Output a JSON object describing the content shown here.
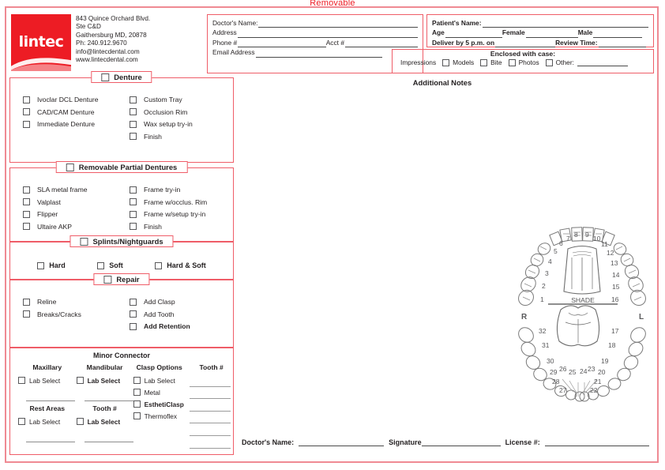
{
  "document": {
    "title": "Removable",
    "additional_notes_label": "Additional Notes"
  },
  "company": {
    "name": "lintec",
    "address_line1": "843 Quince Orchard Blvd.",
    "address_line2": "Ste C&D",
    "address_line3": "Gaithersburg MD, 20878",
    "phone": "Ph: 240.912.9670",
    "email": "info@lintecdental.com",
    "website": "www.lintecdental.com",
    "brand_color": "#ed1c24"
  },
  "doctor_box": {
    "name_label": "Doctor's Name:",
    "address_label": "Address",
    "phone_label": "Phone #",
    "acct_label": "Acct #",
    "email_label": "Email Address"
  },
  "patient_box": {
    "name_label": "Patient's Name:",
    "age_label": "Age",
    "female_label": "Female",
    "male_label": "Male",
    "deliver_label": "Deliver by 5 p.m. on",
    "review_label": "Review Time:"
  },
  "enclosed_box": {
    "title": "Enclosed with case:",
    "items": [
      {
        "label": "Impressions",
        "has_checkbox": false
      },
      {
        "label": "Models",
        "has_checkbox": true
      },
      {
        "label": "Bite",
        "has_checkbox": true
      },
      {
        "label": "Photos",
        "has_checkbox": true
      },
      {
        "label": "Other:",
        "has_checkbox": true
      }
    ]
  },
  "sections": {
    "denture": {
      "title": "Denture",
      "left": [
        "Ivoclar DCL Denture",
        "CAD/CAM Denture",
        "Immediate Denture"
      ],
      "right": [
        "Custom Tray",
        "Occlusion Rim",
        "Wax setup try-in",
        "Finish"
      ]
    },
    "rpd": {
      "title": "Removable Partial Dentures",
      "left": [
        "SLA metal frame",
        "Valplast",
        "Flipper",
        "Ultaire AKP"
      ],
      "right": [
        "Frame try-in",
        "Frame w/occlus. Rim",
        "Frame w/setup try-in",
        "Finish"
      ]
    },
    "splints": {
      "title": "Splints/Nightguards",
      "options": [
        "Hard",
        "Soft",
        "Hard & Soft"
      ]
    },
    "repair": {
      "title": "Repair",
      "left": [
        "Reline",
        "Breaks/Cracks"
      ],
      "right": [
        "Add Clasp",
        "Add Tooth",
        "Add Retention"
      ]
    },
    "minor_connector": {
      "title": "Minor Connector",
      "columns": [
        {
          "header": "Maxillary",
          "option": "Lab Select"
        },
        {
          "header": "Mandibular",
          "option": "Lab Select"
        },
        {
          "header": "Clasp Options",
          "options": [
            "Lab Select",
            "Metal",
            "EsthetiClasp",
            "Thermoflex"
          ]
        },
        {
          "header": "Tooth #",
          "line_count": 6
        }
      ],
      "row2": [
        {
          "header": "Rest Areas",
          "option": "Lab Select"
        },
        {
          "header": "Tooth #",
          "option": "Lab Select"
        }
      ]
    }
  },
  "signature": {
    "doctor_name_label": "Doctor's Name:",
    "signature_label": "Signature",
    "license_label": "License #:"
  },
  "tooth_chart": {
    "shade_label": "SHADE",
    "right_label": "R",
    "left_label": "L",
    "upper_numbers": [
      1,
      2,
      3,
      4,
      5,
      6,
      7,
      8,
      9,
      10,
      11,
      12,
      13,
      14,
      15,
      16
    ],
    "lower_numbers": [
      17,
      18,
      19,
      20,
      21,
      22,
      23,
      24,
      25,
      26,
      27,
      28,
      29,
      30,
      31,
      32
    ]
  }
}
